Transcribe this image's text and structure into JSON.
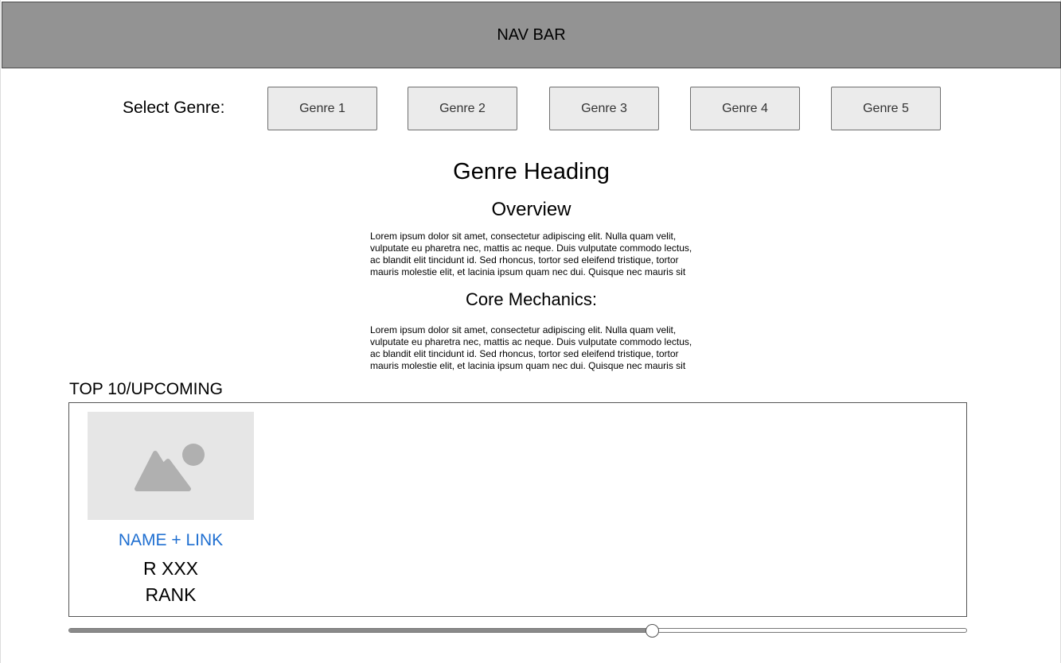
{
  "navbar": {
    "label": "NAV BAR"
  },
  "genre_select": {
    "label": "Select Genre:",
    "buttons": [
      "Genre 1",
      "Genre 2",
      "Genre 3",
      "Genre 4",
      "Genre 5"
    ]
  },
  "genre": {
    "heading": "Genre Heading",
    "overview_heading": "Overview",
    "overview_text": "Lorem ipsum dolor sit amet, consectetur adipiscing elit. Nulla quam velit, vulputate eu pharetra nec, mattis ac neque. Duis vulputate commodo lectus, ac blandit elit tincidunt id. Sed rhoncus, tortor sed eleifend tristique, tortor mauris molestie elit, et lacinia ipsum quam nec dui. Quisque nec mauris sit",
    "core_heading": "Core Mechanics:",
    "core_text": "Lorem ipsum dolor sit amet, consectetur adipiscing elit. Nulla quam velit, vulputate eu pharetra nec, mattis ac neque. Duis vulputate commodo lectus, ac blandit elit tincidunt id. Sed rhoncus, tortor sed eleifend tristique, tortor mauris molestie elit, et lacinia ipsum quam nec dui. Quisque nec mauris sit"
  },
  "top10": {
    "title": "TOP 10/UPCOMING",
    "card": {
      "image_icon": "image-placeholder-icon",
      "name_link": "NAME + LINK",
      "rating": "R XXX",
      "rank": "RANK"
    }
  },
  "slider": {
    "value_fraction": 0.65
  },
  "colors": {
    "navbar_bg": "#939393",
    "link": "#1f6fd1",
    "button_bg": "#ebebeb",
    "placeholder_bg": "#e6e6e6",
    "placeholder_icon": "#b0b0b0"
  }
}
